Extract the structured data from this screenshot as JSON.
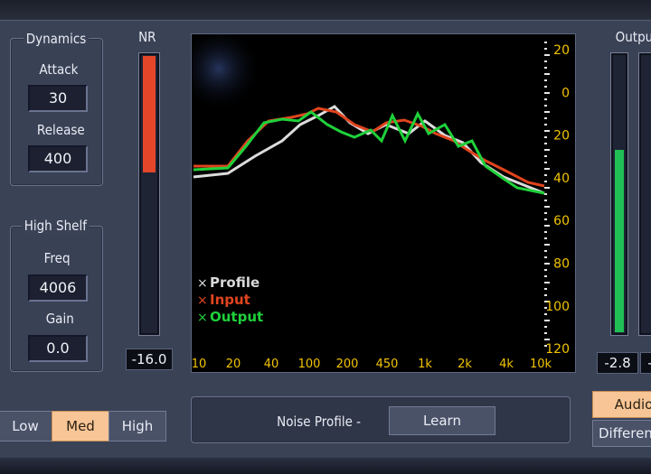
{
  "dynamics": {
    "title": "Dynamics",
    "attack_label": "Attack",
    "attack_value": "30",
    "release_label": "Release",
    "release_value": "400"
  },
  "high_shelf": {
    "title": "High Shelf",
    "freq_label": "Freq",
    "freq_value": "4006",
    "gain_label": "Gain",
    "gain_value": "0.0"
  },
  "nr_meter": {
    "title": "NR",
    "readout": "-16.0",
    "level": 0.42,
    "color": "#e4462a"
  },
  "output_meter": {
    "title": "Output",
    "readout_left": "-2.8",
    "readout_right": "-",
    "level": 0.66,
    "color": "#1fbf55"
  },
  "spectrum": {
    "y_ticks": [
      "20",
      "0",
      "20",
      "40",
      "60",
      "80",
      "100",
      "120"
    ],
    "x_ticks": [
      "10",
      "20",
      "40",
      "100",
      "200",
      "450",
      "1k",
      "2k",
      "4k",
      "10k"
    ],
    "legend": [
      {
        "label": "Profile",
        "color": "#d9d9d9"
      },
      {
        "label": "Input",
        "color": "#e0441e"
      },
      {
        "label": "Output",
        "color": "#1fd13a"
      }
    ]
  },
  "quality": {
    "low": "Low",
    "med": "Med",
    "high": "High",
    "selected": "Med"
  },
  "noise_profile": {
    "label": "Noise Profile -",
    "learn": "Learn"
  },
  "monitor": {
    "audio": "Audio",
    "difference": "Difference"
  },
  "colors": {
    "accent_selected": "#f7c596",
    "graph_axis": "#f2c400"
  }
}
